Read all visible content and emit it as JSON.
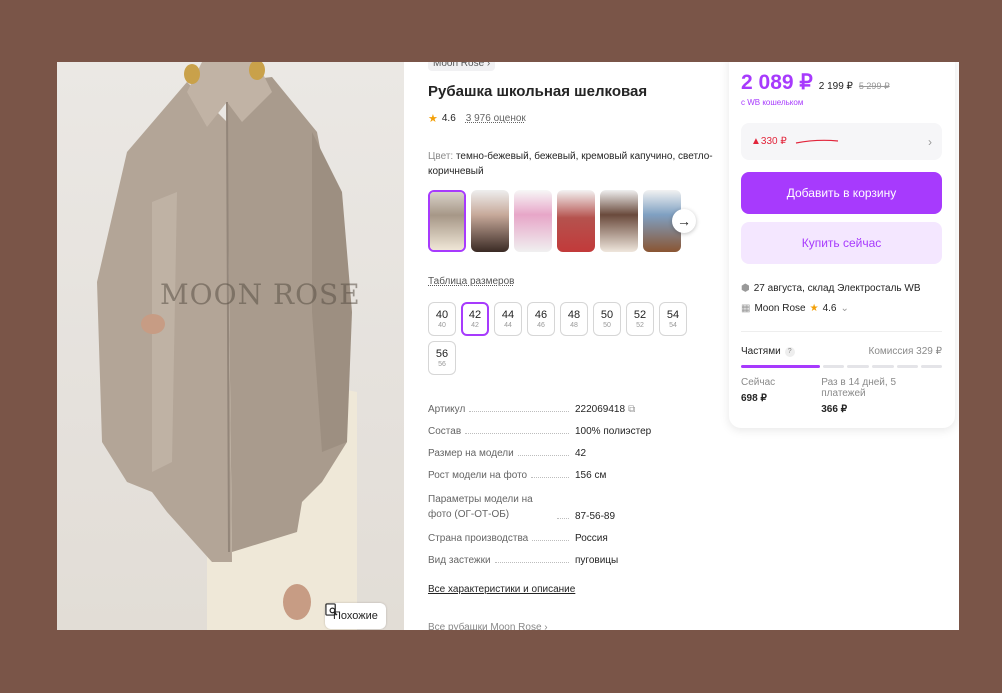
{
  "brand_crumb": "Moon Rose ›",
  "product_title": "Рубашка школьная шелковая",
  "rating": "4.6",
  "reviews": "3 976 оценок",
  "color_label": "Цвет:",
  "color_value": "темно-бежевый, бежевый, кремовый капучино, светло-коричневый",
  "photo": {
    "watermark": "MOON ROSE",
    "similar_label": "Похожие"
  },
  "size_table_link": "Таблица размеров",
  "sizes": [
    {
      "big": "40",
      "small": "40"
    },
    {
      "big": "42",
      "small": "42"
    },
    {
      "big": "44",
      "small": "44"
    },
    {
      "big": "46",
      "small": "46"
    },
    {
      "big": "48",
      "small": "48"
    },
    {
      "big": "50",
      "small": "50"
    },
    {
      "big": "52",
      "small": "52"
    },
    {
      "big": "54",
      "small": "54"
    },
    {
      "big": "56",
      "small": "56"
    }
  ],
  "selected_size": "42",
  "specs": [
    {
      "k": "Артикул",
      "v": "222069418"
    },
    {
      "k": "Состав",
      "v": "100% полиэстер"
    },
    {
      "k": "Размер на модели",
      "v": "42"
    },
    {
      "k": "Рост модели на фото",
      "v": "156 см"
    },
    {
      "k": "Параметры модели на фото (ОГ-ОТ-ОБ)",
      "v": "87-56-89"
    },
    {
      "k": "Страна производства",
      "v": "Россия"
    },
    {
      "k": "Вид застежки",
      "v": "пуговицы"
    }
  ],
  "all_characteristics": "Все характеристики и описание",
  "all_shirts": "Все рубашки Moon Rose ›",
  "card": {
    "price": "2 089 ₽",
    "price_alt": "2 199 ₽",
    "price_old": "5 299 ₽",
    "wallet": "с WB кошельком",
    "discount": "▲330 ₽",
    "add_to_cart": "Добавить в корзину",
    "buy_now": "Купить сейчас",
    "delivery": "27 августа, склад Электросталь WB",
    "seller_name": "Moon Rose",
    "seller_rating": "4.6",
    "installments": "Частями",
    "commission": "Комиссия 329 ₽",
    "now_label": "Сейчас",
    "now_value": "698 ₽",
    "schedule_label": "Раз в 14 дней, 5 платежей",
    "schedule_value": "366 ₽"
  },
  "colors": {
    "accent": "#a73afd",
    "accent_light": "#f4e7ff",
    "discount_red": "#e2253b",
    "frame_bg": "#7a5548"
  }
}
